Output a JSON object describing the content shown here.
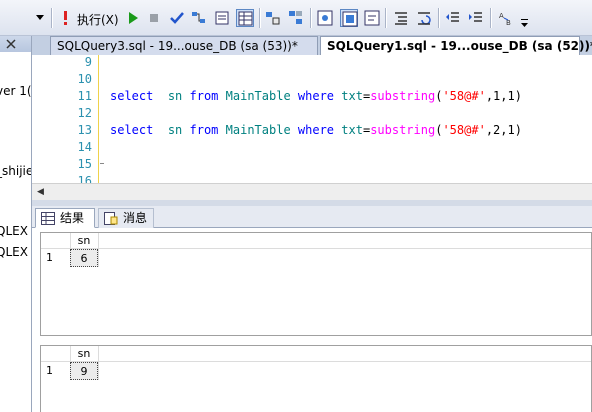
{
  "toolbar": {
    "execute_label": "执行(X)"
  },
  "left_panel": {
    "snippets": [
      "ver 1(",
      "_shijie",
      "QLEX",
      "QLEX"
    ]
  },
  "tabs": [
    {
      "label": "SQLQuery3.sql - 19...ouse_DB (sa (53))*",
      "active": false
    },
    {
      "label": "SQLQuery1.sql - 19...ouse_DB (sa (52))*",
      "active": true
    }
  ],
  "editor": {
    "line_numbers": [
      "9",
      "10",
      "11",
      "12",
      "13",
      "14",
      "15",
      "16"
    ],
    "line11": {
      "kw1": "select",
      "col": "sn",
      "kw2": "from",
      "table": "MainTable",
      "kw3": "where",
      "col2": "txt",
      "op": "=",
      "fn": "substring",
      "open": "(",
      "str": "'58@#'",
      "args": ",1,1)"
    },
    "line13": {
      "kw1": "select",
      "col": "sn",
      "kw2": "from",
      "table": "MainTable",
      "kw3": "where",
      "col2": "txt",
      "op": "=",
      "fn": "substring",
      "open": "(",
      "str": "'58@#'",
      "args": ",2,1)"
    }
  },
  "results_tabs": [
    {
      "label": "结果"
    },
    {
      "label": "消息"
    }
  ],
  "results": [
    {
      "header": "sn",
      "rows": [
        {
          "row_num": "1",
          "value": "6"
        }
      ]
    },
    {
      "header": "sn",
      "rows": [
        {
          "row_num": "1",
          "value": "9"
        }
      ]
    }
  ]
}
